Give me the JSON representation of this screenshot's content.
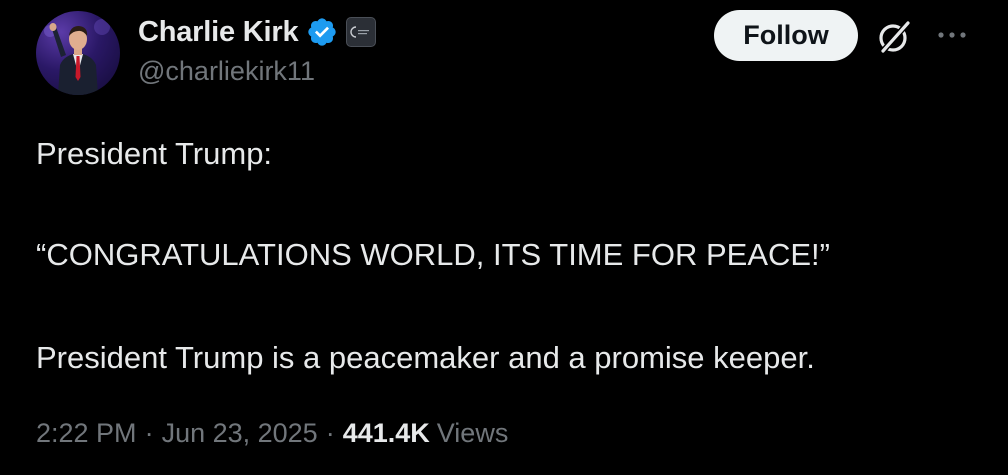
{
  "author": {
    "display_name": "Charlie Kirk",
    "handle": "@charliekirk11",
    "verified_icon": "verified-badge-icon",
    "affiliate_icon": "affiliate-badge-icon"
  },
  "actions": {
    "follow_label": "Follow",
    "grok_icon": "grok-icon",
    "more_icon": "more-options-icon"
  },
  "tweet": {
    "lines": [
      "President Trump:",
      "“CONGRATULATIONS WORLD, ITS TIME FOR PEACE!”",
      "President Trump is a peacemaker and a promise keeper."
    ]
  },
  "meta": {
    "time": "2:22 PM",
    "separator": "·",
    "date": "Jun 23, 2025",
    "views_count": "441.4K",
    "views_label": "Views"
  },
  "colors": {
    "background": "#000000",
    "primary_text": "#e7e9ea",
    "secondary_text": "#71767b",
    "verified_blue": "#1d9bf0",
    "follow_button_bg": "#eff3f4"
  }
}
